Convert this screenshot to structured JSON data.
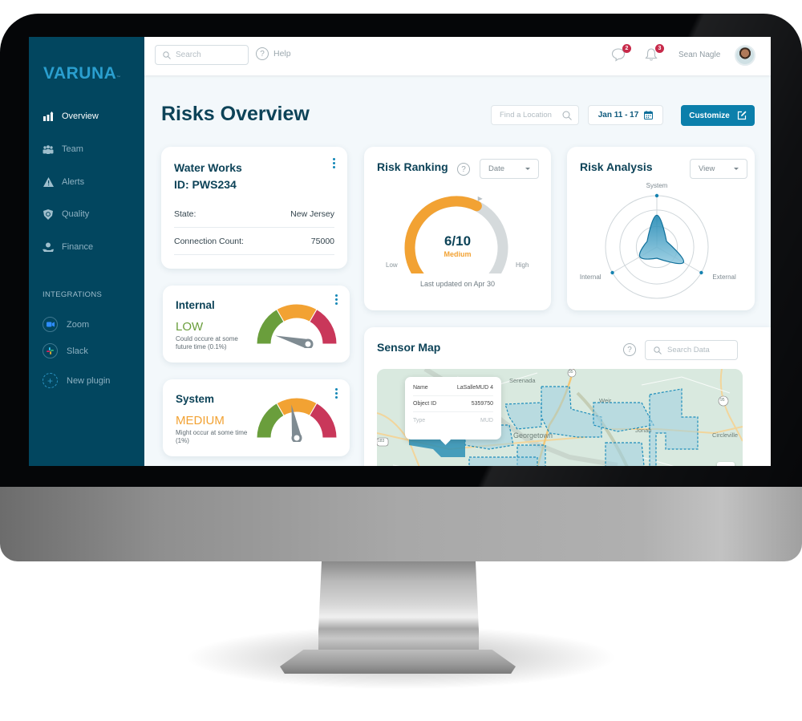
{
  "sidebar": {
    "logo": "VARUNA",
    "logo_mark": "™",
    "nav": [
      {
        "label": "Overview",
        "icon": "bar-chart-icon",
        "active": true
      },
      {
        "label": "Team",
        "icon": "team-icon",
        "active": false
      },
      {
        "label": "Alerts",
        "icon": "warning-icon",
        "active": false
      },
      {
        "label": "Quality",
        "icon": "shield-icon",
        "active": false
      },
      {
        "label": "Finance",
        "icon": "finance-icon",
        "active": false
      }
    ],
    "integrations_label": "INTEGRATIONS",
    "integrations": [
      {
        "label": "Zoom",
        "icon": "zoom-icon"
      },
      {
        "label": "Slack",
        "icon": "slack-icon"
      },
      {
        "label": "New plugin",
        "icon": "plus-icon"
      }
    ]
  },
  "topbar": {
    "search_placeholder": "Search",
    "help_label": "Help",
    "messages_count": "2",
    "notifications_count": "3",
    "user_name": "Sean Nagle"
  },
  "header": {
    "title": "Risks Overview",
    "find_location_placeholder": "Find a Location",
    "date_range": "Jan 11 - 17",
    "customize_label": "Customize"
  },
  "water_works": {
    "title_line1": "Water Works",
    "title_line2": "ID: PWS234",
    "rows": [
      {
        "label": "State:",
        "value": "New Jersey"
      },
      {
        "label": "Connection Count:",
        "value": "75000"
      }
    ]
  },
  "risk_cards": [
    {
      "title": "Internal",
      "level": "LOW",
      "level_color": "#6a9e3c",
      "description": "Could occure at some future time (0.1%)",
      "needle_fraction": 0.08
    },
    {
      "title": "System",
      "level": "MEDIUM",
      "level_color": "#f2a233",
      "description": "Might occur at some time (1%)",
      "needle_fraction": 0.45
    }
  ],
  "risk_ranking": {
    "title": "Risk Ranking",
    "dropdown": "Date",
    "score": "6/10",
    "score_value": 6,
    "score_max": 10,
    "level": "Medium",
    "low_label": "Low",
    "high_label": "High",
    "updated": "Last updated on Apr 30"
  },
  "risk_analysis": {
    "title": "Risk Analysis",
    "dropdown": "View",
    "axes": [
      {
        "label": "System",
        "value": 0.62
      },
      {
        "label": "External",
        "value": 0.6
      },
      {
        "label": "Internal",
        "value": 0.38
      }
    ]
  },
  "sensor_map": {
    "title": "Sensor Map",
    "search_placeholder": "Search Data",
    "tooltip": [
      {
        "label": "Name",
        "value": "LaSalleMUD 4"
      },
      {
        "label": "Object ID",
        "value": "5359750"
      },
      {
        "label": "Type",
        "value": "MUD"
      }
    ],
    "places": [
      "Serenada",
      "Weir",
      "Georgetown",
      "Jonah",
      "Circleville"
    ],
    "route_shields": [
      "183",
      "35",
      "95"
    ]
  },
  "colors": {
    "sidebar": "#02465f",
    "accent": "#0b7fab",
    "title": "#0d4358",
    "gauge_green": "#6a9e3c",
    "gauge_orange": "#f2a233",
    "gauge_red": "#c9375a",
    "badge": "#c72a4a"
  }
}
